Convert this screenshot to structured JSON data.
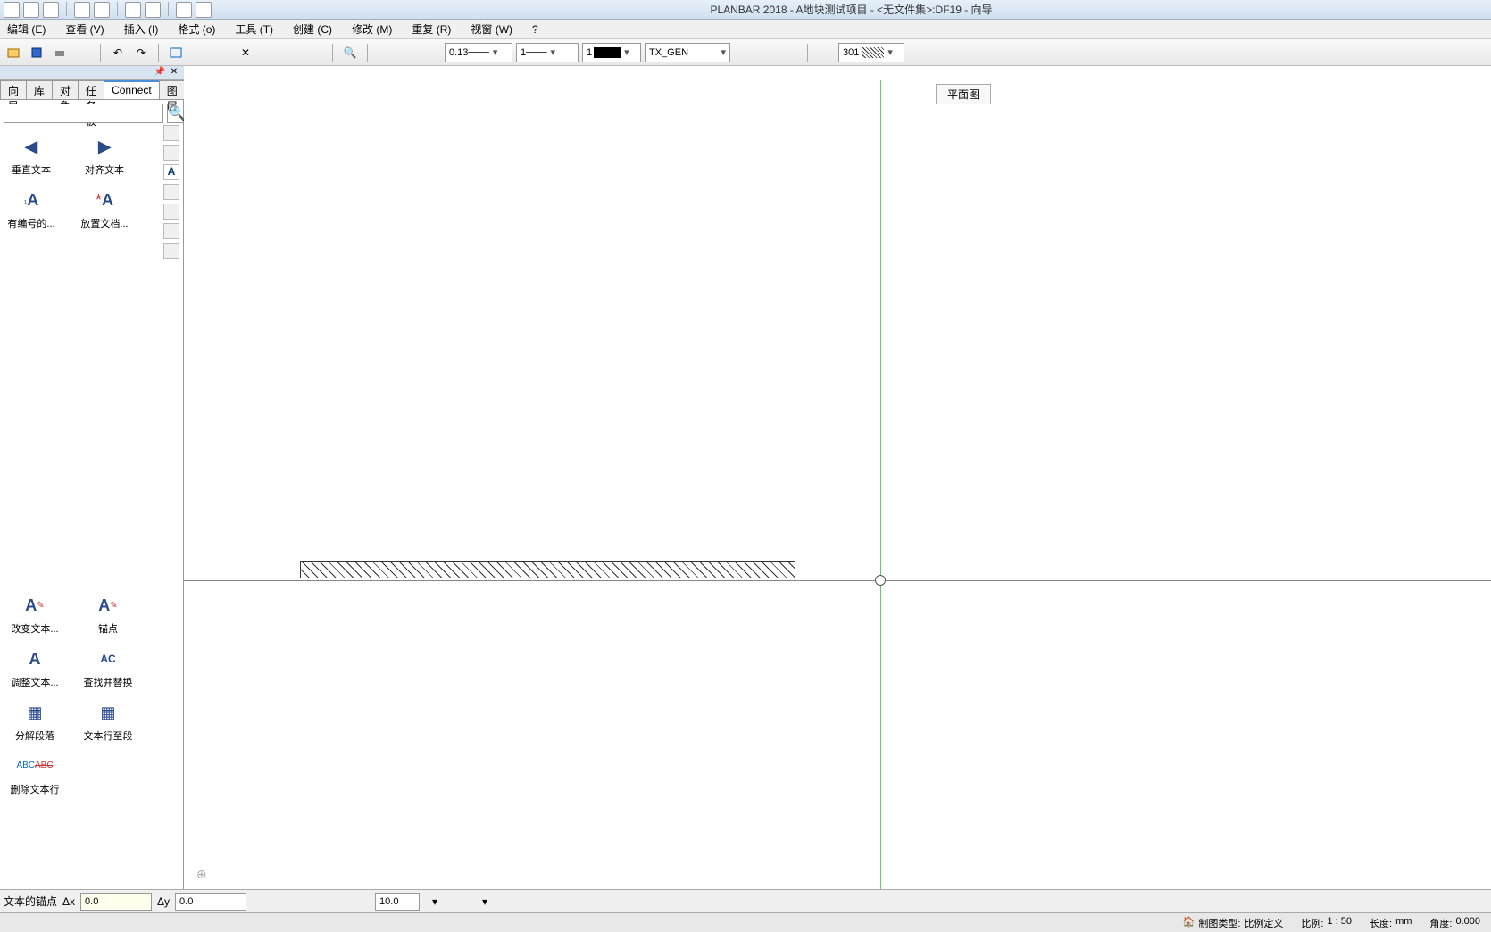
{
  "app": {
    "title": "PLANBAR 2018 - A地块测试项目 - <无文件集>:DF19 - 向导"
  },
  "menu": {
    "edit": "编辑  (E)",
    "view": "查看  (V)",
    "insert": "插入  (I)",
    "format": "格式  (o)",
    "tool": "工具  (T)",
    "create": "创建  (C)",
    "modify": "修改  (M)",
    "repeat": "重复  (R)",
    "window": "视窗  (W)",
    "help": "?"
  },
  "toolbar": {
    "linewidth": "0.13",
    "linetype": "1",
    "color_idx": "1",
    "layer": "TX_GEN",
    "hatch_num": "301"
  },
  "tabs": {
    "t1": "向导",
    "t2": "库",
    "t3": "对象",
    "t4": "任务板",
    "t5": "Connect",
    "t6": "图层"
  },
  "tools_top": {
    "vert_text": "垂直文本",
    "align_text": "对齐文本",
    "numbered": "有编号的...",
    "place_doc": "放置文档..."
  },
  "tools_bottom": {
    "change_text": "改变文本...",
    "anchor": "锚点",
    "adjust_text": "调整文本...",
    "find_replace": "查找并替换",
    "split_para": "分解段落",
    "line_to_para": "文本行至段",
    "del_line": "删除文本行"
  },
  "viewport": {
    "label": "平面图"
  },
  "input_bar": {
    "prompt": "文本的锚点",
    "dx_label": "Δx",
    "dx_value": "0.0",
    "dy_label": "Δy",
    "dy_value": "0.0",
    "snap_value": "10.0"
  },
  "status": {
    "drawing_type_label": "制图类型:",
    "drawing_type_value": "比例定义",
    "scale_label": "比例:",
    "scale_value": "1 : 50",
    "length_label": "长度:",
    "length_value": "mm",
    "angle_label": "角度:",
    "angle_value": "0.000"
  }
}
